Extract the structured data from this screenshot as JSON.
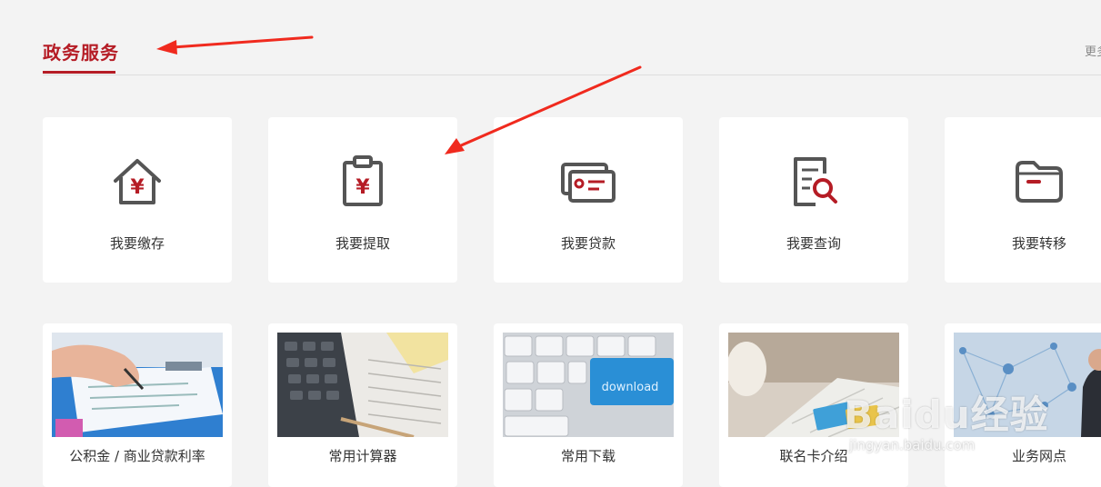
{
  "section": {
    "title": "政务服务",
    "more_label": "更多"
  },
  "services": [
    {
      "label": "我要缴存",
      "icon": "house-yuan-icon"
    },
    {
      "label": "我要提取",
      "icon": "clipboard-yuan-icon"
    },
    {
      "label": "我要贷款",
      "icon": "cards-icon"
    },
    {
      "label": "我要查询",
      "icon": "document-search-icon"
    },
    {
      "label": "我要转移",
      "icon": "folder-icon"
    }
  ],
  "links": [
    {
      "label": "公积金 / 商业贷款利率",
      "image": "document-signing-photo"
    },
    {
      "label": "常用计算器",
      "image": "calculator-photo"
    },
    {
      "label": "常用下载",
      "image": "keyboard-download-photo"
    },
    {
      "label": "联名卡介绍",
      "image": "bank-card-keyboard-photo"
    },
    {
      "label": "业务网点",
      "image": "network-business-photo"
    }
  ],
  "watermark": {
    "text": "Baidu经验",
    "url": "jingyan.baidu.com"
  },
  "colors": {
    "accent": "#b51c25",
    "icon_gray": "#555555",
    "background": "#f3f3f3",
    "arrow": "#f02a1e"
  }
}
